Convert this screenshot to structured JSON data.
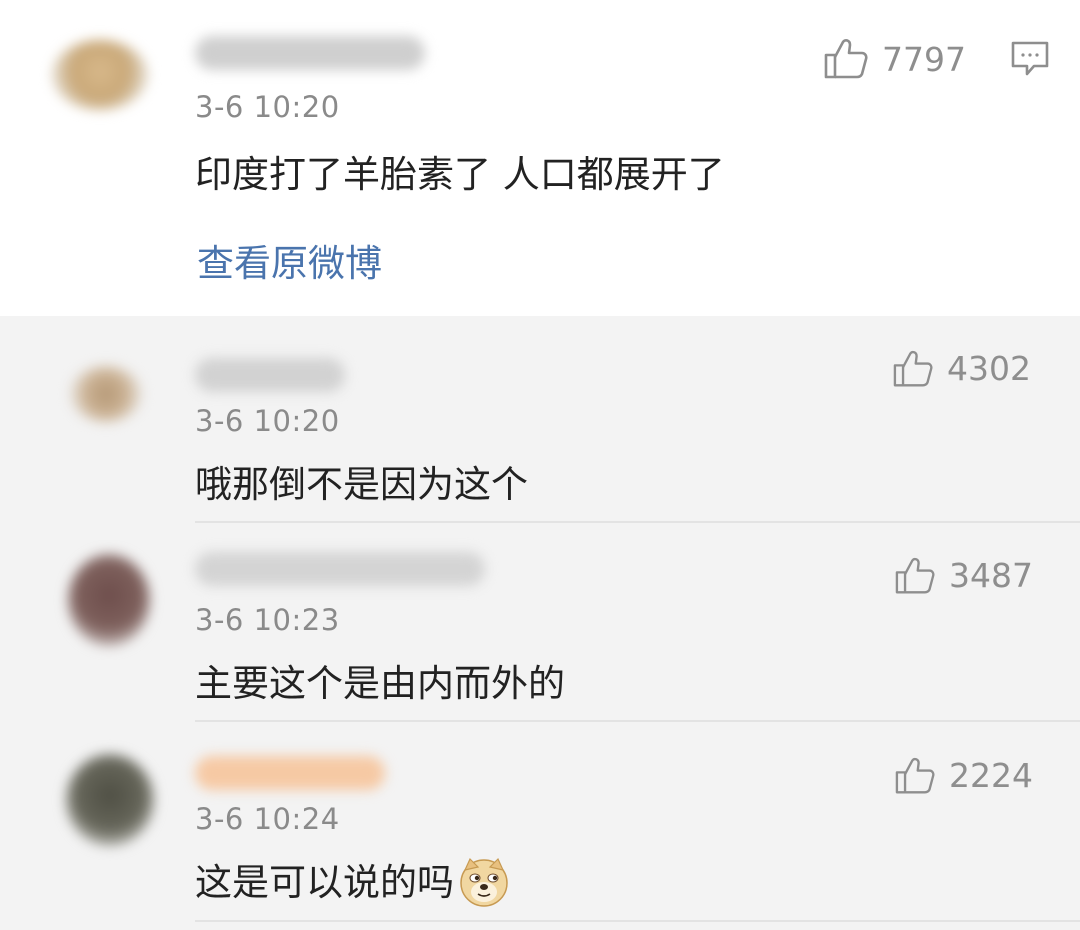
{
  "main_comment": {
    "time": "3-6 10:20",
    "likes": "7797",
    "text": "印度打了羊胎素了 人口都展开了",
    "link": "查看原微博",
    "avatar_color": "#c9a878",
    "name_blur_color": "#cfcfcf"
  },
  "replies": [
    {
      "time": "3-6 10:20",
      "likes": "4302",
      "text": "哦那倒不是因为这个",
      "avatar_color": "#b59876",
      "name_blur_color": "#d2d2d2"
    },
    {
      "time": "3-6 10:23",
      "likes": "3487",
      "text": "主要这个是由内而外的",
      "avatar_color": "#6e4e4c",
      "name_blur_color": "#d4d4d4"
    },
    {
      "time": "3-6 10:24",
      "likes": "2224",
      "text": "这是可以说的吗",
      "emoji": "doge-emoji",
      "avatar_color": "#57574a",
      "name_blur_color": "#f6c9a4"
    }
  ],
  "colors": {
    "link": "#4a74ad",
    "text": "#222222",
    "muted": "#8a8a8a",
    "reply_bg": "#f3f3f3"
  },
  "icons": {
    "like": "thumbs-up-icon",
    "reply": "comment-bubble-icon"
  }
}
